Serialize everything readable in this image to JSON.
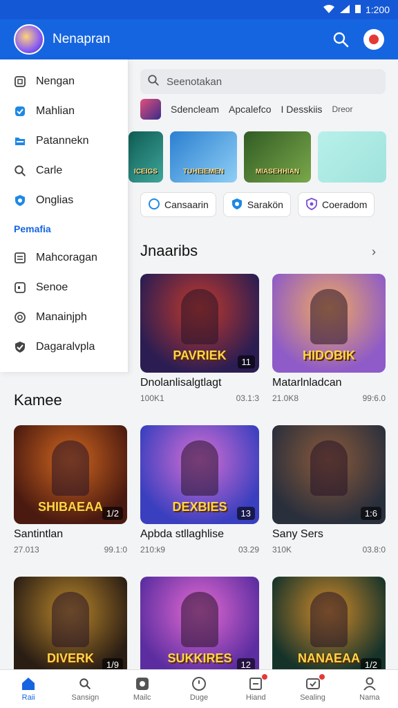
{
  "status": {
    "time": "1:200"
  },
  "app": {
    "title": "Nenapran"
  },
  "drawer": {
    "items": [
      {
        "label": "Nengan",
        "icon": "frame-icon"
      },
      {
        "label": "Mahlian",
        "icon": "check-badge-icon"
      },
      {
        "label": "Patannekn",
        "icon": "folder-icon"
      },
      {
        "label": "Carle",
        "icon": "search-icon"
      },
      {
        "label": "Onglias",
        "icon": "shield-icon"
      }
    ],
    "section": "Pemafia",
    "items2": [
      {
        "label": "Mahcoragan",
        "icon": "list-icon"
      },
      {
        "label": "Senoe",
        "icon": "square-icon"
      },
      {
        "label": "Manainjph",
        "icon": "gear-icon"
      },
      {
        "label": "Dagaralvpla",
        "icon": "shield-check-icon"
      }
    ]
  },
  "search": {
    "placeholder": "Seenotakan"
  },
  "categories": [
    "Sdencleam",
    "Apcalefco",
    "I Desskiis",
    "Dreor"
  ],
  "banners": [
    {
      "art": "ICEIGS",
      "colors": [
        "#0e5d54",
        "#3fa59a"
      ]
    },
    {
      "art": "TUHEIEMEN",
      "colors": [
        "#2b7fd1",
        "#8fcff5"
      ]
    },
    {
      "art": "MIASEHHIAN",
      "colors": [
        "#315c24",
        "#7aa84a"
      ]
    },
    {
      "art": "",
      "colors": [
        "#b8f0ea",
        "#9fe3dc"
      ]
    }
  ],
  "chips": [
    {
      "label": "Cansaarin",
      "icon": "circle-icon"
    },
    {
      "label": "Sarakön",
      "icon": "shield-icon"
    },
    {
      "label": "Coeradom",
      "icon": "mask-icon"
    }
  ],
  "section1": {
    "title": "Jnaaribs"
  },
  "section2": {
    "title": "Kamee"
  },
  "cards_top": [
    {
      "name": "Dnolanlisalgtlagt",
      "downloads": "100K1",
      "date": "03.1:3",
      "badge": "11",
      "art": "PAVRIEK",
      "colors": [
        "#2b1d52",
        "#c2392b"
      ]
    },
    {
      "name": "Matarlnladcan",
      "downloads": "21.0K8",
      "date": "99:6.0",
      "badge": "",
      "art": "HIDOBIK",
      "colors": [
        "#8e5bc8",
        "#f0a860"
      ]
    }
  ],
  "cards": [
    {
      "name": "Santintlan",
      "downloads": "27.013",
      "date": "99.1:0",
      "badge": "1/2",
      "art": "SHIBAEAA",
      "colors": [
        "#4a1a10",
        "#d0661f"
      ]
    },
    {
      "name": "Apbda stllaghlise",
      "downloads": "210:k9",
      "date": "03.29",
      "badge": "13",
      "art": "DEXBIES",
      "colors": [
        "#3a3fbf",
        "#d86fd3"
      ]
    },
    {
      "name": "Sany Sers",
      "downloads": "310K",
      "date": "03.8:0",
      "badge": "1:6",
      "art": "",
      "colors": [
        "#2a2f3c",
        "#8b5a3a"
      ]
    },
    {
      "name": "",
      "downloads": "",
      "date": "",
      "badge": "1/9",
      "art": "DIVERK",
      "colors": [
        "#2a1d14",
        "#b8862b"
      ]
    },
    {
      "name": "",
      "downloads": "",
      "date": "",
      "badge": "12",
      "art": "SUKKIRES",
      "colors": [
        "#5b2da0",
        "#e56ad2"
      ]
    },
    {
      "name": "",
      "downloads": "",
      "date": "",
      "badge": "1/2",
      "art": "NANAEAA",
      "colors": [
        "#16332a",
        "#d08a2a"
      ]
    }
  ],
  "tabs": [
    {
      "label": "Raii",
      "icon": "home-icon",
      "active": true
    },
    {
      "label": "Sansign",
      "icon": "search-icon",
      "active": false
    },
    {
      "label": "Mailc",
      "icon": "game-icon",
      "active": false
    },
    {
      "label": "Duge",
      "icon": "clock-icon",
      "active": false
    },
    {
      "label": "Hiand",
      "icon": "doc-icon",
      "active": false,
      "dot": true
    },
    {
      "label": "Sealing",
      "icon": "settings-icon",
      "active": false,
      "dot": true
    },
    {
      "label": "Nama",
      "icon": "user-icon",
      "active": false
    }
  ]
}
